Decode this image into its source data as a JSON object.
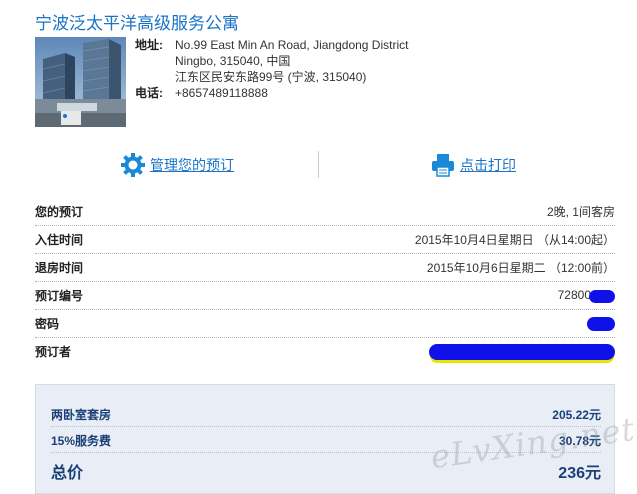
{
  "hotel": {
    "name": "宁波泛太平洋高级服务公寓",
    "address_label": "地址:",
    "address_line1": "No.99 East Min An Road, Jiangdong District",
    "address_line2": "Ningbo, 315040, 中国",
    "address_line3": "江东区民安东路99号 (宁波, 315040)",
    "phone_label": "电话:",
    "phone": "+8657489118888"
  },
  "actions": {
    "manage_label": "管理您的预订",
    "print_label": "点击打印"
  },
  "details": [
    {
      "label": "您的预订",
      "value": "2晚, 1间客房"
    },
    {
      "label": "入住时间",
      "value": "2015年10月4日星期日 （从14:00起）"
    },
    {
      "label": "退房时间",
      "value": "2015年10月6日星期二 （12:00前）"
    },
    {
      "label": "预订编号",
      "value": "72800"
    },
    {
      "label": "密码",
      "value": ""
    },
    {
      "label": "预订者",
      "value": ""
    }
  ],
  "prices": [
    {
      "label": "两卧室套房",
      "value": "205.22元"
    },
    {
      "label": "15%服务费",
      "value": "30.78元"
    },
    {
      "label": "总价",
      "value": "236元"
    }
  ],
  "watermark": "eLvXing.net",
  "colors": {
    "link": "#1a73c6",
    "price_text": "#1a3f78",
    "price_box_bg": "#e9eef6",
    "redaction": "#1010e8"
  }
}
